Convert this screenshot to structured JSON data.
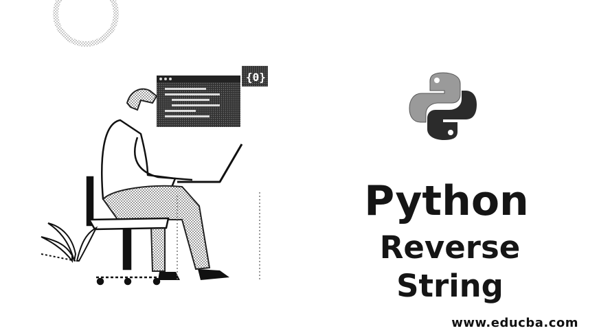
{
  "title": {
    "line1": "Python",
    "line2": "Reverse String"
  },
  "footer": {
    "url": "www.educba.com"
  },
  "icons": {
    "logo": "python-logo-icon",
    "illustration": "developer-at-laptop-illustration"
  },
  "colors": {
    "background": "#ffffff",
    "text": "#151515",
    "logo_dark": "#2b2b2b",
    "logo_light": "#9a9a9a"
  }
}
